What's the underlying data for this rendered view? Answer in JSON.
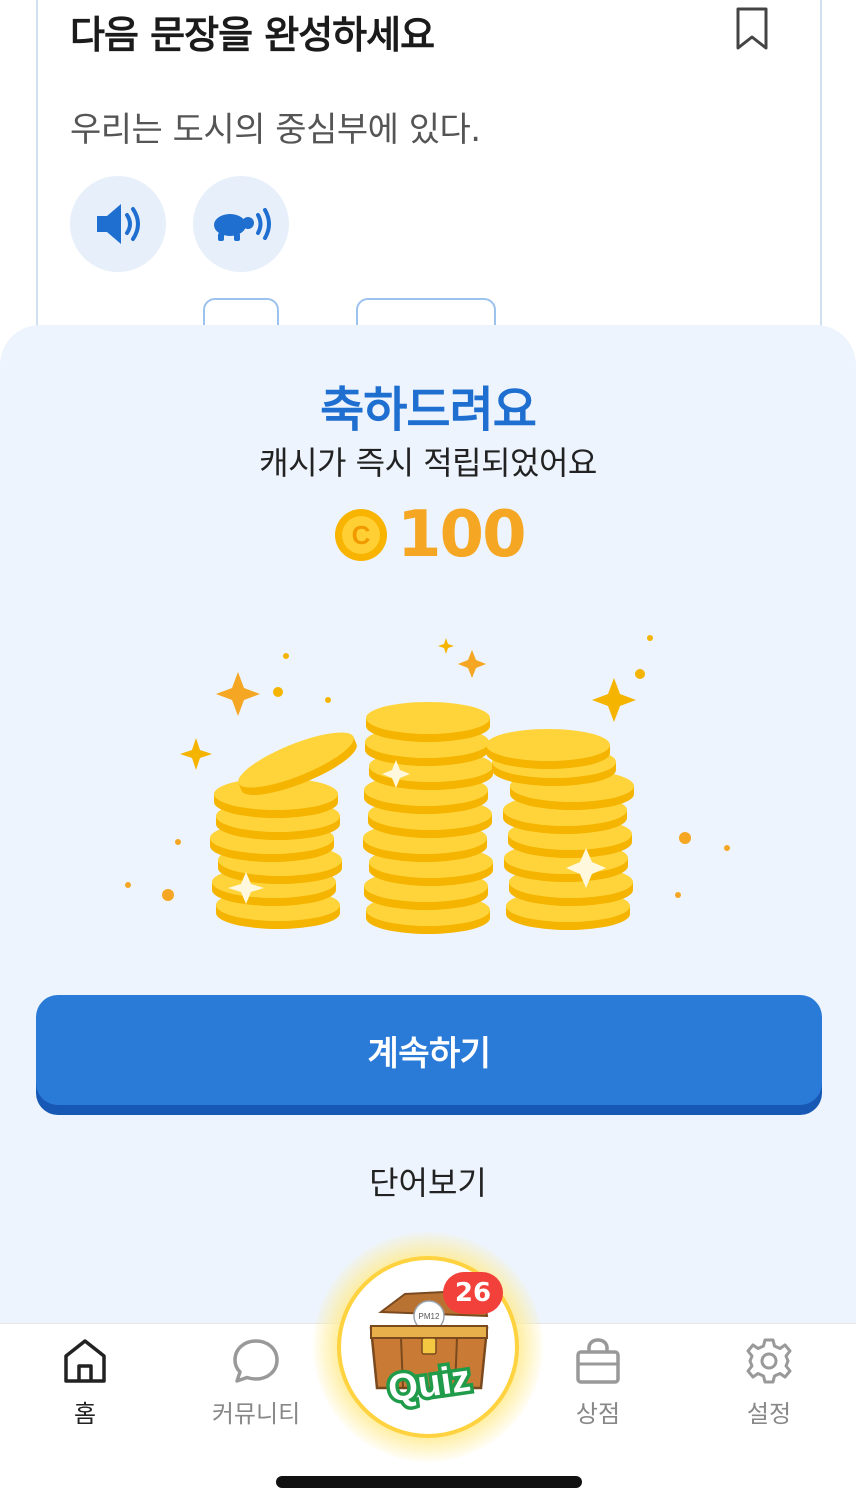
{
  "question": {
    "title": "다음 문장을 완성하세요",
    "sentence": "우리는 도시의 중심부에 있다.",
    "icons": {
      "bookmark": "bookmark-icon",
      "audio_normal": "speaker-icon",
      "audio_slow": "turtle-speaker-icon"
    }
  },
  "reward": {
    "title": "축하드려요",
    "subtitle": "캐시가 즉시 적립되었어요",
    "coin_letter": "C",
    "amount": "100"
  },
  "actions": {
    "continue_label": "계속하기",
    "view_words_label": "단어보기"
  },
  "tabbar": {
    "home": "홈",
    "community": "커뮤니티",
    "shop": "상점",
    "settings": "설정",
    "quiz_badge": "26",
    "quiz_label": "Quiz",
    "quiz_chest_text": "PM12"
  },
  "colors": {
    "accent": "#2a7ad8",
    "title_blue": "#1f6fd0",
    "coin_gold": "#f5a623",
    "sheet_bg": "#edf4fd",
    "badge_red": "#f2403a"
  }
}
